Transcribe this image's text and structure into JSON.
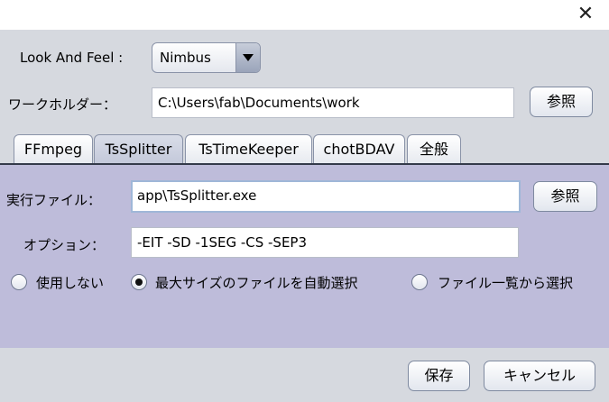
{
  "titlebar": {
    "close_label": "✕"
  },
  "laf": {
    "label": "Look And Feel :",
    "value": "Nimbus"
  },
  "work": {
    "label": "ワークホルダー：",
    "value": "C:\\Users\\fab\\Documents\\work",
    "browse_label": "参照"
  },
  "tabs": [
    {
      "label": "FFmpeg",
      "selected": false
    },
    {
      "label": "TsSplitter",
      "selected": true
    },
    {
      "label": "TsTimeKeeper",
      "selected": false
    },
    {
      "label": "chotBDAV",
      "selected": false
    },
    {
      "label": "全般",
      "selected": false
    }
  ],
  "panel": {
    "exe_label": "実行ファイル：",
    "exe_value": "app\\TsSplitter.exe",
    "browse_label": "参照",
    "option_label": "オプション：",
    "option_value": "-EIT -SD -1SEG -CS -SEP3",
    "radios": [
      {
        "label": "使用しない",
        "selected": false
      },
      {
        "label": "最大サイズのファイルを自動選択",
        "selected": true
      },
      {
        "label": "ファイル一覧から選択",
        "selected": false
      }
    ]
  },
  "footer": {
    "save_label": "保存",
    "cancel_label": "キャンセル"
  }
}
